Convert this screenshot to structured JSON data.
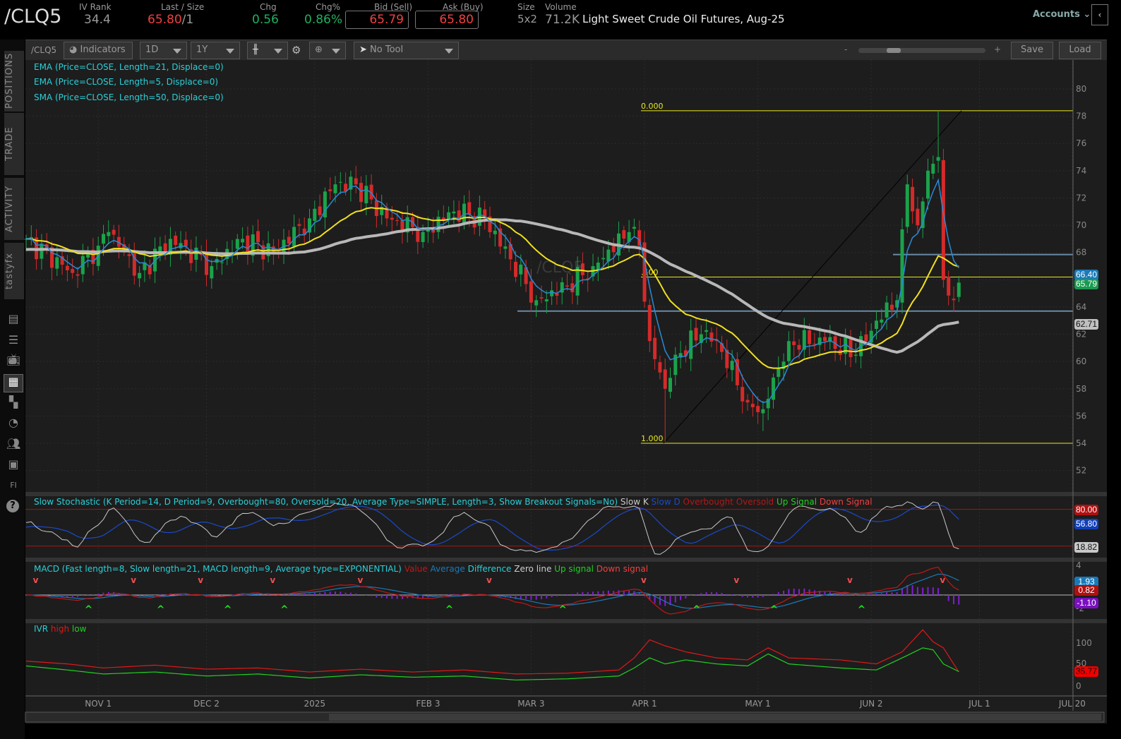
{
  "header": {
    "symbol": "/CLQ5",
    "iv_rank_label": "IV Rank",
    "iv_rank": "34.4",
    "last_label": "Last / Size",
    "last": "65.80",
    "size": "/1",
    "chg_label": "Chg",
    "chg": "0.56",
    "chgpct_label": "Chg%",
    "chgpct": "0.86%",
    "bid_label": "Bid (Sell)",
    "bid": "65.79",
    "ask_label": "Ask (Buy)",
    "ask": "65.80",
    "size_label": "Size",
    "size_val": "5x2",
    "volume_label": "Volume",
    "volume": "71.2K",
    "description": "Light Sweet Crude Oil Futures, Aug-25",
    "accounts": "Accounts"
  },
  "toolbar": {
    "symbol": "/CLQ5",
    "indicators": "Indicators",
    "aggregation": "1D",
    "period": "1Y",
    "tool": "No Tool",
    "zoom_minus": "-",
    "zoom_plus": "+",
    "save": "Save",
    "load": "Load"
  },
  "sidebar": {
    "tabs": [
      "POSITIONS",
      "TRADE",
      "ACTIVITY",
      "tastyfx"
    ]
  },
  "studies": {
    "ema21": "EMA (Price=CLOSE, Length=21, Displace=0)",
    "ema5": "EMA (Price=CLOSE, Length=5, Displace=0)",
    "sma50": "SMA (Price=CLOSE, Length=50, Displace=0)",
    "stoch": "Slow Stochastic (K Period=14, D Period=9, Overbought=80, Oversold=20, Average Type=SIMPLE, Length=3, Show Breakout Signals=No)",
    "stoch_legend": [
      "Slow K",
      "Slow D",
      "Overbought",
      "Oversold",
      "Up Signal",
      "Down Signal"
    ],
    "macd": "MACD (Fast length=8, Slow length=21, MACD length=9, Average type=EXPONENTIAL)",
    "macd_legend": [
      "Value",
      "Average",
      "Difference",
      "Zero line",
      "Up signal",
      "Down signal"
    ],
    "ivr": "IVR",
    "ivr_legend": [
      "high",
      "low"
    ]
  },
  "watermark": "/CLQ5",
  "colors": {
    "up": "#1aa34a",
    "down": "#d42a2a",
    "ema21": "#f0e020",
    "ema5": "#2a8ad8",
    "sma50": "#b8b8b8",
    "fib": "#e8e820",
    "level": "#6a8aa8"
  },
  "chart_data": {
    "type": "candlestick",
    "symbol": "/CLQ5",
    "y_ticks": [
      80,
      78,
      76,
      74,
      72,
      70,
      68,
      66,
      64,
      62,
      60,
      58,
      56,
      54,
      52
    ],
    "ylim": [
      51,
      81
    ],
    "x_ticks": [
      {
        "label": "NOV 1",
        "bar": 14
      },
      {
        "label": "DEC 2",
        "bar": 35
      },
      {
        "label": "2025",
        "bar": 56
      },
      {
        "label": "FEB 3",
        "bar": 78
      },
      {
        "label": "MAR 3",
        "bar": 98
      },
      {
        "label": "APR 1",
        "bar": 120
      },
      {
        "label": "MAY 1",
        "bar": 142
      },
      {
        "label": "JUN 2",
        "bar": 164
      },
      {
        "label": "JUL 1",
        "bar": 185
      },
      {
        "label": "JUL 20",
        "bar": 203
      }
    ],
    "close_keypoints": [
      [
        0,
        69
      ],
      [
        9,
        66.5
      ],
      [
        14,
        68.5
      ],
      [
        16,
        69.5
      ],
      [
        22,
        66.5
      ],
      [
        28,
        69
      ],
      [
        36,
        67
      ],
      [
        42,
        69
      ],
      [
        48,
        68
      ],
      [
        55,
        70.5
      ],
      [
        60,
        73
      ],
      [
        64,
        73
      ],
      [
        70,
        70.5
      ],
      [
        77,
        69.5
      ],
      [
        83,
        71
      ],
      [
        89,
        70.5
      ],
      [
        94,
        67.5
      ],
      [
        99,
        64.5
      ],
      [
        105,
        65.5
      ],
      [
        110,
        67
      ],
      [
        117,
        69.5
      ],
      [
        119,
        68.5
      ],
      [
        121,
        61.5
      ],
      [
        124,
        58
      ],
      [
        126,
        60.5
      ],
      [
        131,
        62
      ],
      [
        134,
        61.5
      ],
      [
        140,
        57
      ],
      [
        143,
        56.5
      ],
      [
        146,
        59.5
      ],
      [
        148,
        61.5
      ],
      [
        155,
        61.5
      ],
      [
        161,
        60.5
      ],
      [
        165,
        63
      ],
      [
        169,
        64.5
      ],
      [
        171,
        73
      ],
      [
        173,
        70
      ],
      [
        175,
        74
      ],
      [
        177,
        75
      ],
      [
        178,
        66
      ],
      [
        180,
        64.5
      ],
      [
        181,
        65.79
      ]
    ],
    "fib": [
      {
        "label": "0.000",
        "value": 78.4
      },
      {
        "label": ".500",
        "value": 66.2
      },
      {
        "label": "1.000",
        "value": 54.0
      }
    ],
    "levels": [
      67.85,
      63.7
    ],
    "price_tags": [
      {
        "label": "66.40",
        "color": "#1a7ab8"
      },
      {
        "label": "65.79",
        "color": "#1a9a50"
      },
      {
        "label": "62.71",
        "color": "#c0c0c0"
      }
    ],
    "stoch": {
      "ob": 80,
      "os": 20,
      "ticks": [],
      "tags": [
        {
          "label": "80.00",
          "color": "#b01010"
        },
        {
          "label": "56.80",
          "color": "#1040b8"
        },
        {
          "label": "18.82",
          "color": "#c8c8c8"
        }
      ]
    },
    "macd": {
      "ticks": [
        "4",
        "-2"
      ],
      "tags": [
        {
          "label": "1.93",
          "color": "#1a7ab8"
        },
        {
          "label": "0.82",
          "color": "#b01010"
        },
        {
          "label": "-1.10",
          "color": "#7a10c0"
        }
      ]
    },
    "ivr": {
      "ticks": [
        "100",
        "50",
        "0"
      ],
      "tag": "35.77",
      "high_keypoints": [
        [
          0,
          62
        ],
        [
          8,
          55
        ],
        [
          15,
          45
        ],
        [
          25,
          52
        ],
        [
          35,
          42
        ],
        [
          45,
          45
        ],
        [
          55,
          35
        ],
        [
          65,
          42
        ],
        [
          75,
          35
        ],
        [
          85,
          40
        ],
        [
          95,
          30
        ],
        [
          105,
          32
        ],
        [
          115,
          40
        ],
        [
          118,
          70
        ],
        [
          121,
          115
        ],
        [
          124,
          100
        ],
        [
          128,
          85
        ],
        [
          134,
          70
        ],
        [
          140,
          65
        ],
        [
          144,
          95
        ],
        [
          148,
          70
        ],
        [
          158,
          65
        ],
        [
          165,
          55
        ],
        [
          170,
          85
        ],
        [
          174,
          140
        ],
        [
          176,
          110
        ],
        [
          178,
          95
        ],
        [
          181,
          35
        ]
      ],
      "low_keypoints": [
        [
          0,
          50
        ],
        [
          8,
          40
        ],
        [
          15,
          30
        ],
        [
          25,
          35
        ],
        [
          35,
          25
        ],
        [
          45,
          30
        ],
        [
          55,
          20
        ],
        [
          65,
          28
        ],
        [
          75,
          22
        ],
        [
          85,
          25
        ],
        [
          95,
          15
        ],
        [
          105,
          18
        ],
        [
          115,
          25
        ],
        [
          118,
          45
        ],
        [
          121,
          70
        ],
        [
          124,
          55
        ],
        [
          128,
          65
        ],
        [
          134,
          55
        ],
        [
          140,
          50
        ],
        [
          144,
          80
        ],
        [
          148,
          55
        ],
        [
          158,
          45
        ],
        [
          165,
          40
        ],
        [
          170,
          70
        ],
        [
          174,
          95
        ],
        [
          176,
          90
        ],
        [
          178,
          55
        ],
        [
          181,
          36
        ]
      ]
    }
  }
}
